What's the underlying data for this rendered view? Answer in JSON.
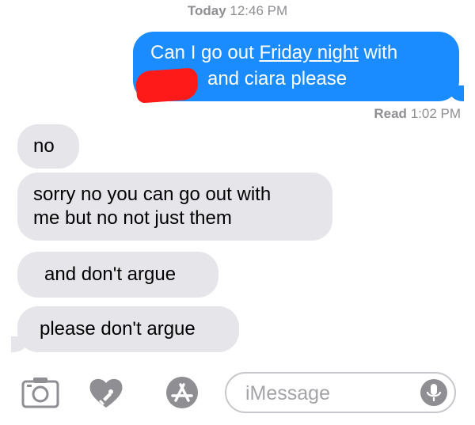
{
  "timestamp": {
    "day": "Today",
    "time": "12:46 PM"
  },
  "outgoing": {
    "line1_pre": "Can I go out ",
    "line1_link": "Friday night",
    "line1_post": " with",
    "line2": "and ciara please"
  },
  "read_receipt": {
    "label": "Read",
    "time": "1:02 PM"
  },
  "incoming": [
    {
      "lines": [
        "no"
      ]
    },
    {
      "lines": [
        "sorry no you can go out with",
        "me but no not just them"
      ]
    },
    {
      "lines": [
        "and don't argue"
      ]
    },
    {
      "lines": [
        "please don't argue"
      ]
    }
  ],
  "input": {
    "placeholder": "iMessage"
  },
  "icons": {
    "camera": "camera-icon",
    "digital_touch": "digital-touch-heart-icon",
    "app_store": "app-store-icon",
    "mic": "microphone-icon"
  },
  "colors": {
    "outgoing_bubble": "#1a8cff",
    "incoming_bubble": "#e5e5ea",
    "redaction": "#ff1a1a",
    "meta_text": "#8e8e93"
  }
}
